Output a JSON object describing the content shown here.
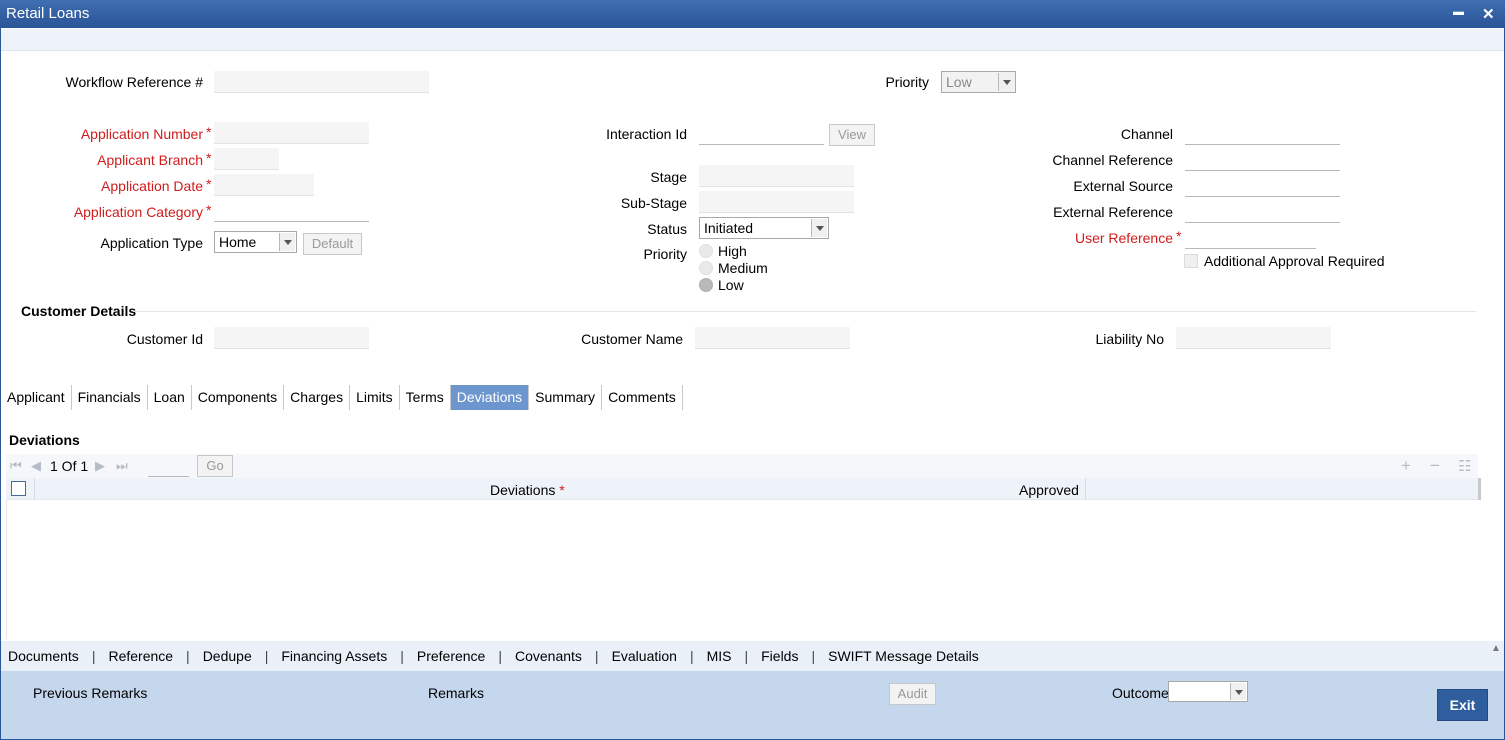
{
  "window": {
    "title": "Retail Loans",
    "minimize": "▬",
    "close": "✕"
  },
  "header": {
    "workflow_ref_label": "Workflow Reference #",
    "workflow_ref_value": "",
    "priority_label": "Priority",
    "priority_value": "Low"
  },
  "left": {
    "application_number_label": "Application Number",
    "applicant_branch_label": "Applicant Branch",
    "application_date_label": "Application Date",
    "application_category_label": "Application Category",
    "application_type_label": "Application Type",
    "application_type_value": "Home",
    "default_button": "Default",
    "required_star": "*"
  },
  "middle": {
    "interaction_id_label": "Interaction Id",
    "view_button": "View",
    "stage_label": "Stage",
    "sub_stage_label": "Sub-Stage",
    "status_label": "Status",
    "status_value": "Initiated",
    "priority_label": "Priority",
    "priority_options": [
      "High",
      "Medium",
      "Low"
    ],
    "priority_selected": "Low"
  },
  "right": {
    "channel_label": "Channel",
    "channel_reference_label": "Channel Reference",
    "external_source_label": "External Source",
    "external_reference_label": "External Reference",
    "user_reference_label": "User Reference",
    "additional_approval_label": "Additional Approval Required"
  },
  "customer": {
    "section_title": "Customer Details",
    "customer_id_label": "Customer Id",
    "customer_name_label": "Customer Name",
    "liability_no_label": "Liability No"
  },
  "tabs": [
    "Applicant",
    "Financials",
    "Loan",
    "Components",
    "Charges",
    "Limits",
    "Terms",
    "Deviations",
    "Summary",
    "Comments"
  ],
  "active_tab": "Deviations",
  "deviations": {
    "section_title": "Deviations",
    "pager_text": "1 Of 1",
    "go_button": "Go",
    "col_deviations": "Deviations",
    "col_approved": "Approved",
    "icons": [
      "add-icon",
      "remove-icon",
      "list-icon"
    ]
  },
  "links": [
    "Documents",
    "Reference",
    "Dedupe",
    "Financing Assets",
    "Preference",
    "Covenants",
    "Evaluation",
    "MIS",
    "Fields",
    "SWIFT Message Details"
  ],
  "footer": {
    "previous_remarks": "Previous Remarks",
    "remarks": "Remarks",
    "audit_button": "Audit",
    "outcome_label": "Outcome",
    "outcome_value": "",
    "exit_button": "Exit"
  }
}
